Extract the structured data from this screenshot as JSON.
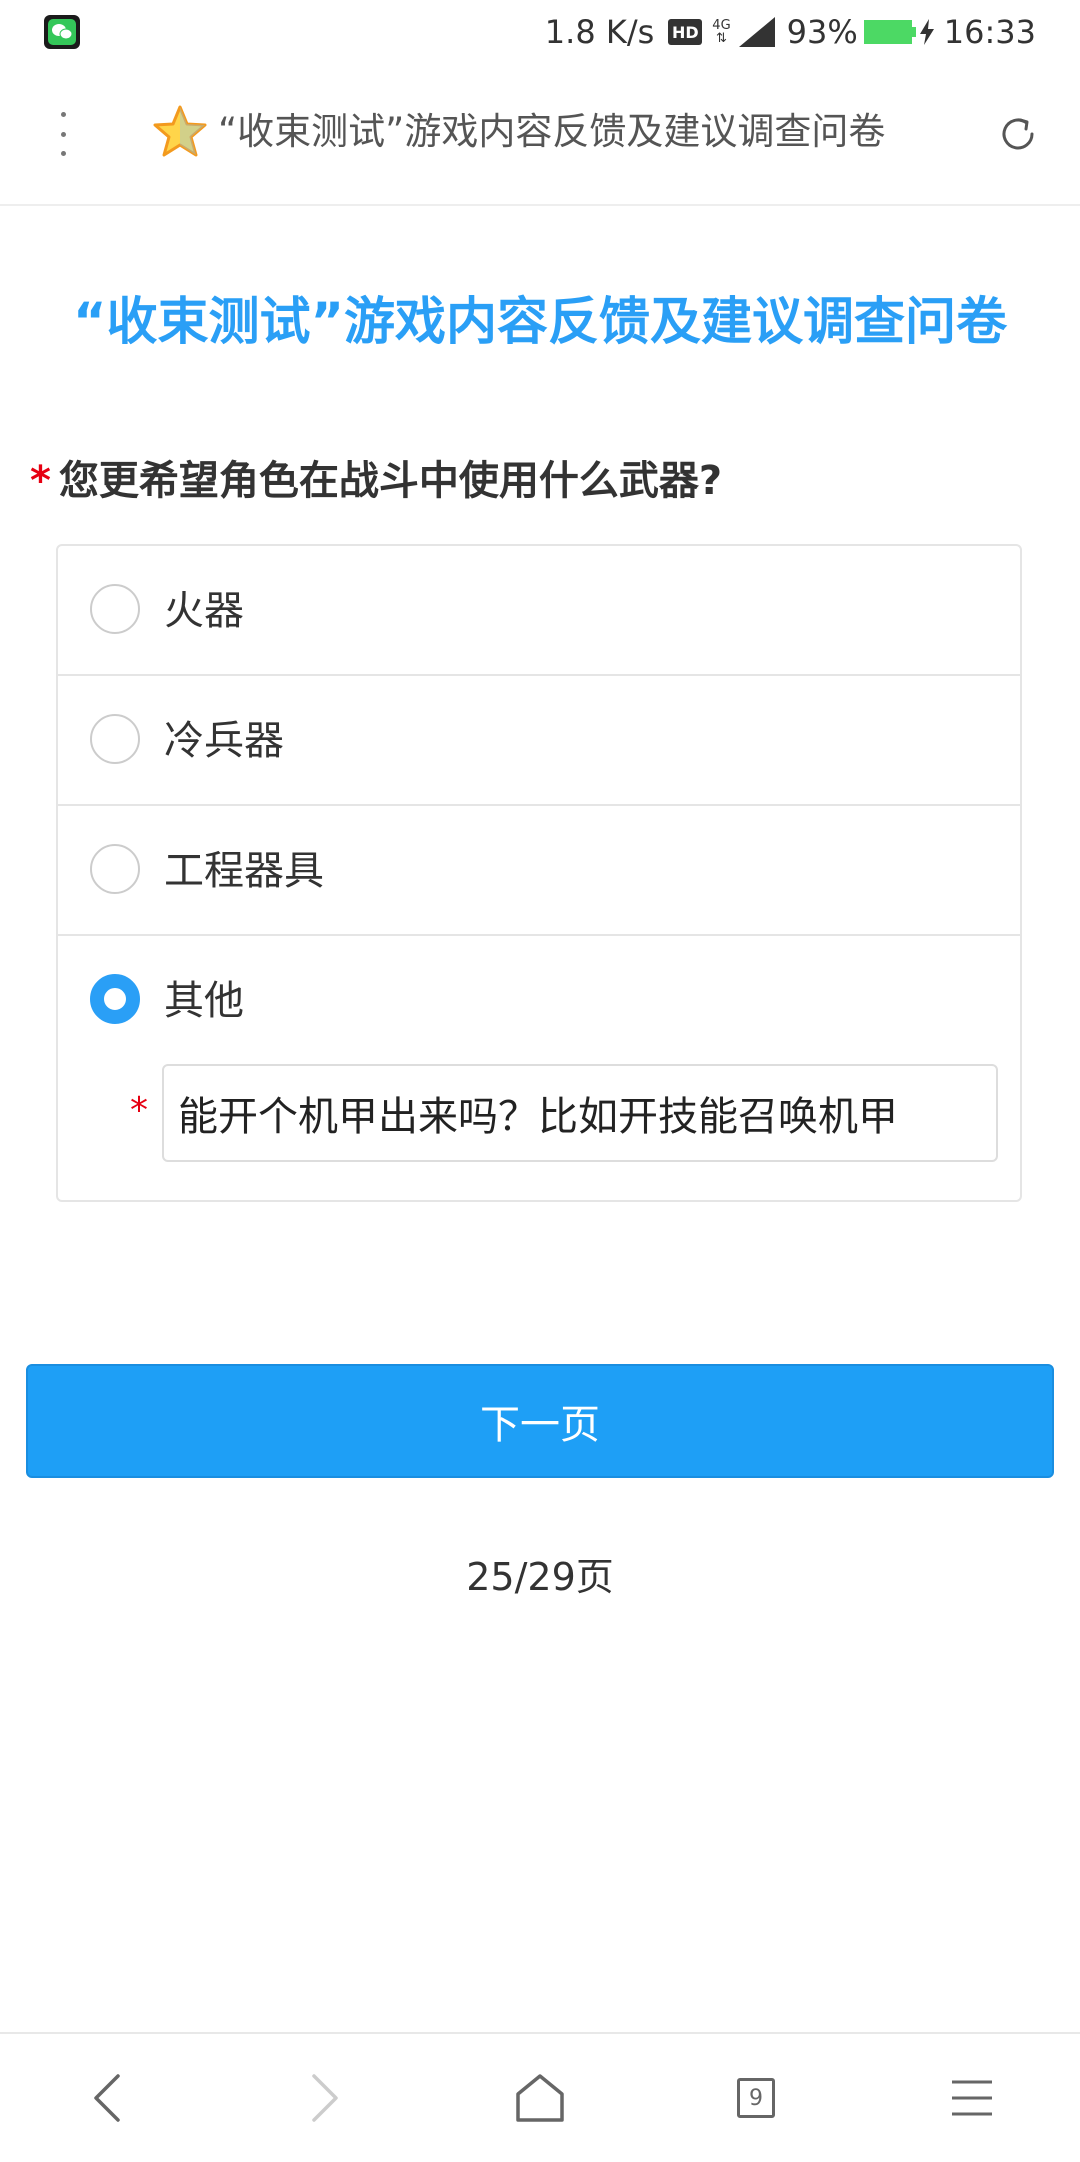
{
  "status_bar": {
    "net_speed": "1.8 K/s",
    "hd_label": "HD",
    "network_type": "4G",
    "battery": "93%",
    "time": "16:33"
  },
  "browser": {
    "page_title": "“收束测试”游戏内容反馈及建议调查问卷",
    "icons": {
      "menu": "more-vertical-icon",
      "bookmark": "star-icon",
      "refresh": "refresh-icon"
    }
  },
  "survey": {
    "title": "“收束测试”游戏内容反馈及建议调查问卷",
    "accent_color": "#2a9ff6",
    "question": {
      "required_mark": "*",
      "text": "您更希望角色在战斗中使用什么武器?",
      "options": [
        {
          "label": "火器",
          "selected": false
        },
        {
          "label": "冷兵器",
          "selected": false
        },
        {
          "label": "工程器具",
          "selected": false
        },
        {
          "label": "其他",
          "selected": true
        }
      ],
      "other_required_mark": "*",
      "other_value": "能开个机甲出来吗？比如开技能召唤机甲"
    },
    "next_button_label": "下一页",
    "page_indicator": "25/29页"
  },
  "bottom_nav": {
    "tab_count": "9",
    "icons": [
      "back-icon",
      "forward-icon",
      "home-icon",
      "tabs-icon",
      "menu-icon"
    ]
  }
}
